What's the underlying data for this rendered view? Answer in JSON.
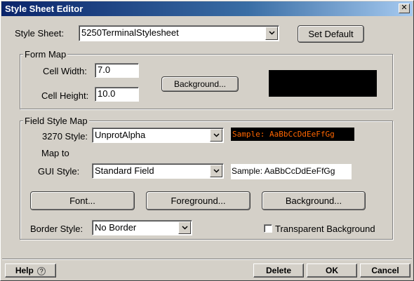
{
  "window": {
    "title": "Style Sheet Editor",
    "close_glyph": "✕"
  },
  "stylesheet": {
    "label": "Style Sheet:",
    "value": "5250TerminalStylesheet",
    "set_default_label": "Set Default"
  },
  "form_map": {
    "title": "Form Map",
    "cell_width_label": "Cell Width:",
    "cell_width_value": "7.0",
    "cell_height_label": "Cell Height:",
    "cell_height_value": "10.0",
    "background_label": "Background...",
    "preview_color": "#000000"
  },
  "field_style_map": {
    "title": "Field Style Map",
    "style_3270_label": "3270 Style:",
    "style_3270_value": "UnprotAlpha",
    "sample_3270": "Sample: AaBbCcDdEeFfGg",
    "sample_3270_fg": "#ff6600",
    "sample_3270_bg": "#000000",
    "map_to_label": "Map to",
    "gui_style_label": "GUI Style:",
    "gui_style_value": "Standard Field",
    "sample_gui": "Sample: AaBbCcDdEeFfGg",
    "font_label": "Font...",
    "foreground_label": "Foreground...",
    "background_label": "Background...",
    "border_style_label": "Border Style:",
    "border_style_value": "No Border",
    "transparent_label": "Transparent Background",
    "transparent_checked": false
  },
  "footer": {
    "help_label": "Help",
    "help_icon": "?",
    "delete_label": "Delete",
    "ok_label": "OK",
    "cancel_label": "Cancel"
  },
  "icons": {
    "dropdown": "chevron-down-icon",
    "help": "question-circle-icon",
    "close": "close-icon"
  }
}
